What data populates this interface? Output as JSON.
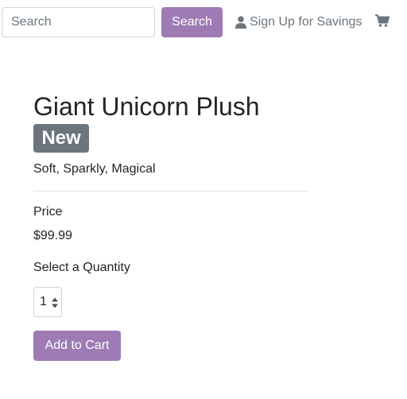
{
  "header": {
    "search": {
      "placeholder": "Search",
      "value": ""
    },
    "search_button_label": "Search",
    "signup_label": "Sign Up for Savings",
    "signup_icon": "user-icon",
    "cart_icon": "shopping-cart-icon"
  },
  "product": {
    "title": "Giant Unicorn Plush",
    "badge": "New",
    "description": "Soft, Sparkly, Magical",
    "price_label": "Price",
    "price": "$99.99",
    "quantity_label": "Select a Quantity",
    "quantity": "1",
    "add_to_cart_label": "Add to Cart"
  },
  "colors": {
    "accent": "#9e7bb5",
    "badge": "#6c757d",
    "muted_text": "#6c757d"
  }
}
